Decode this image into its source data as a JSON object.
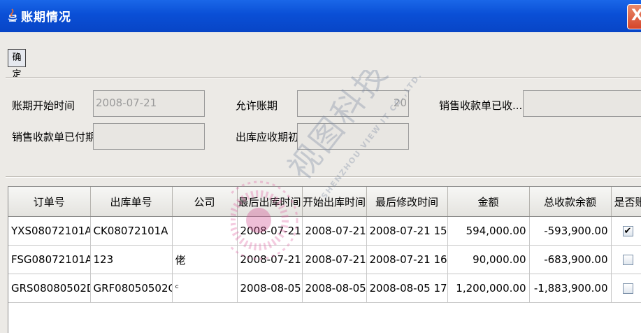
{
  "window": {
    "title": "账期情况",
    "close_glyph": "X"
  },
  "toolbar": {
    "confirm_label": "确定"
  },
  "form": {
    "start_date_label": "账期开始时间",
    "start_date_value": "2008-07-21",
    "allowed_period_label": "允许账期",
    "allowed_period_value": "20",
    "sales_received_label": "销售收款单已收...",
    "sales_received_value": "",
    "sales_paid_label": "销售收款单已付期",
    "sales_paid_value": "",
    "outbound_receivable_label": "出库应收期初",
    "outbound_receivable_value": ""
  },
  "table": {
    "columns": [
      "订单号",
      "出库单号",
      "公司",
      "最后出库时间",
      "开始出库时间",
      "最后修改时间",
      "金额",
      "总收款余额",
      "是否账"
    ],
    "rows": [
      {
        "order": "YXS08072101A",
        "outbound": "CK08072101A",
        "company": "",
        "last_out": "2008-07-21",
        "start_out": "2008-07-21",
        "modified": "2008-07-21 15:...",
        "amount": "594,000.00",
        "balance": "-593,900.00",
        "checked": true
      },
      {
        "order": "FSG08072101A",
        "outbound": "123",
        "company": "佬",
        "last_out": "2008-07-21",
        "start_out": "2008-07-21",
        "modified": "2008-07-21 16:...",
        "amount": "90,000.00",
        "balance": "-683,900.00",
        "checked": false
      },
      {
        "order": "GRS08080502D",
        "outbound": "GRF08050502G",
        "company": "ᶜ",
        "last_out": "2008-08-05",
        "start_out": "2008-08-05",
        "modified": "2008-08-05 17:...",
        "amount": "1,200,000.00",
        "balance": "-1,883,900.00",
        "checked": false
      }
    ]
  },
  "watermark": {
    "cn": "视图科技",
    "en": "SHENZHOU VIEW IT CO.,LTD."
  },
  "colors": {
    "titlebar": "#0a4fd6",
    "close": "#d6452a",
    "panel": "#eceae6"
  }
}
